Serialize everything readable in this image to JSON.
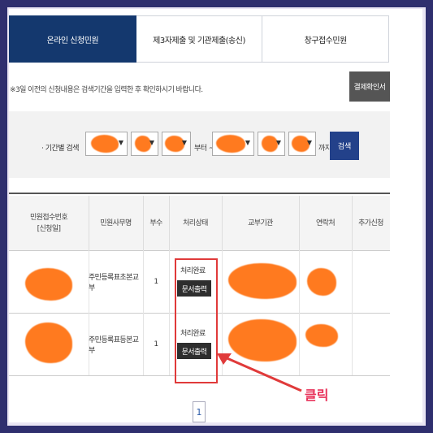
{
  "tabs": [
    {
      "label": "온라인 신청민원",
      "active": true
    },
    {
      "label": "제3자제출 및 기관제출(송신)",
      "active": false
    },
    {
      "label": "창구접수민원",
      "active": false
    }
  ],
  "notice": "※3일 이전의 신청내용은 검색기간을 입력한 후 확인하시기 바랍니다.",
  "receipt_button": "결제확인서",
  "search": {
    "label": "· 기간별 검색",
    "from_suffix": "부터 ~",
    "to_suffix": "까지",
    "button": "검색"
  },
  "table": {
    "headers": [
      "민원접수번호\n[신청일]",
      "민원사무명",
      "부수",
      "처리상태",
      "교부기관",
      "연락처",
      "추가신청"
    ],
    "rows": [
      {
        "service": "주민등록표초본교부",
        "copies": "1",
        "status": "처리완료",
        "action": "문서출력"
      },
      {
        "service": "주민등록표등본교부",
        "copies": "1",
        "status": "처리완료",
        "action": "문서출력"
      }
    ]
  },
  "annotation": {
    "click_label": "클릭",
    "highlight_color": "#e03a3a",
    "arrow_color": "#e03a3a"
  },
  "pagination": {
    "current": "1"
  },
  "colors": {
    "tab_active": "#14386e",
    "search_button": "#23418a",
    "redaction": "#ff7a1f"
  }
}
